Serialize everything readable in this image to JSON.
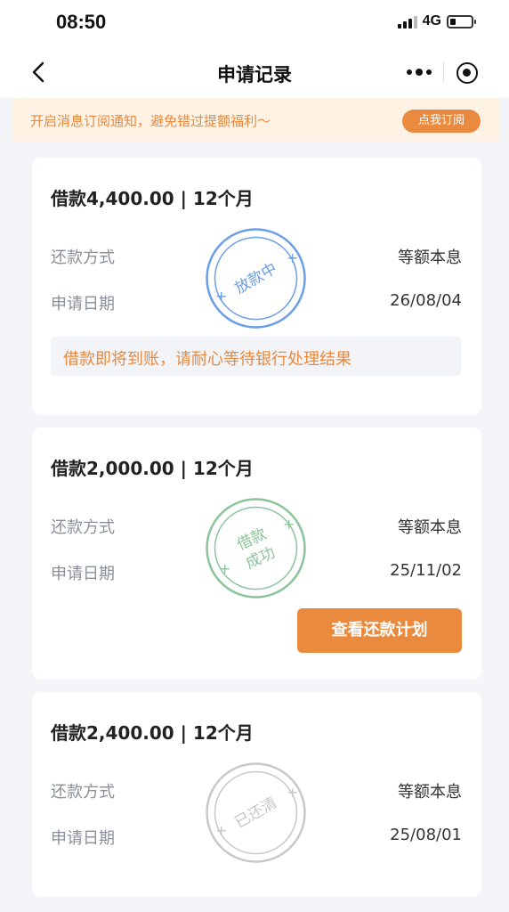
{
  "status_bar": {
    "time": "08:50",
    "network": "4G"
  },
  "nav": {
    "title": "申请记录"
  },
  "notice": {
    "text": "开启消息订阅通知，避免错过提额福利～",
    "button": "点我订阅"
  },
  "labels": {
    "repay_method": "还款方式",
    "apply_date": "申请日期"
  },
  "records": [
    {
      "title": "借款4,400.00 | 12个月",
      "repay_method": "等额本息",
      "apply_date": "26/08/04",
      "stamp": "放款中",
      "stamp_color": "#6b9ee8",
      "message": "借款即将到账，请耐心等待银行处理结果"
    },
    {
      "title": "借款2,000.00 | 12个月",
      "repay_method": "等额本息",
      "apply_date": "25/11/02",
      "stamp_line1": "借款",
      "stamp_line2": "成功",
      "stamp_color": "#8cc49a",
      "button": "查看还款计划"
    },
    {
      "title": "借款2,400.00 | 12个月",
      "repay_method": "等额本息",
      "apply_date": "25/08/01",
      "stamp": "已还清",
      "stamp_color": "#c8c8c8"
    }
  ],
  "colors": {
    "accent": "#e98a3f",
    "notice_bg": "#fdf2e3",
    "page_bg": "#f4f5f8"
  }
}
